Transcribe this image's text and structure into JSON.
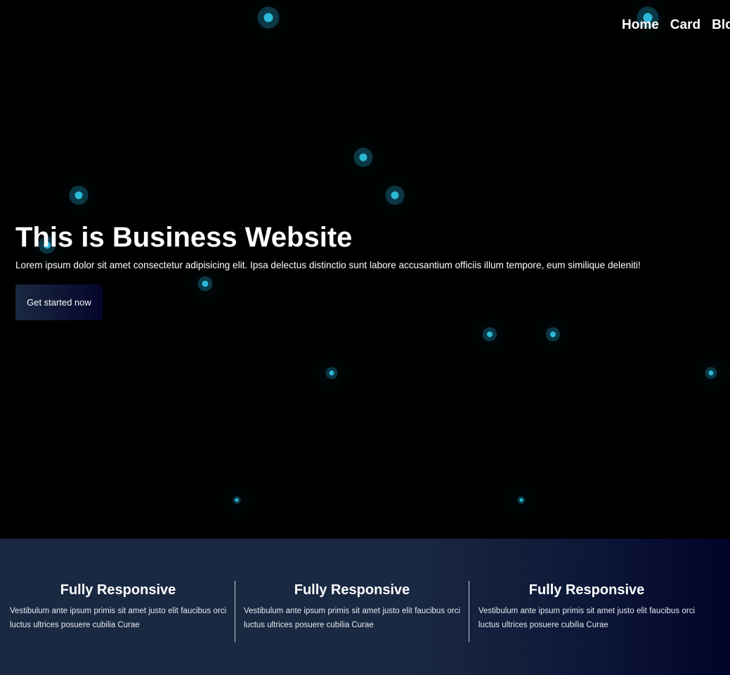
{
  "nav": {
    "items": [
      "Home",
      "Card",
      "Blo"
    ]
  },
  "hero": {
    "title": "This is Business Website",
    "text": "Lorem ipsum dolor sit amet consectetur adipisicing elit. Ipsa delectus distinctio sunt labore accusantium officiis illum tempore, eum similique deleniti!",
    "cta_label": "Get started now"
  },
  "features": [
    {
      "title": "Fully Responsive",
      "text": "Vestibulum ante ipsum primis sit amet justo elit faucibus orci luctus ultrices posuere cubilia Curae"
    },
    {
      "title": "Fully Responsive",
      "text": "Vestibulum ante ipsum primis sit amet justo elit faucibus orci luctus ultrices posuere cubilia Curae"
    },
    {
      "title": "Fully Responsive",
      "text": "Vestibulum ante ipsum primis sit amet justo elit faucibus orci luctus ultrices posuere cubilia Curae"
    }
  ],
  "colors": {
    "background": "#000000",
    "particle": "#2bb8d6",
    "button_gradient_start": "#1a2942",
    "button_gradient_end": "#05052b",
    "features_gradient_start": "#1a2942",
    "features_gradient_end": "#02032a"
  }
}
